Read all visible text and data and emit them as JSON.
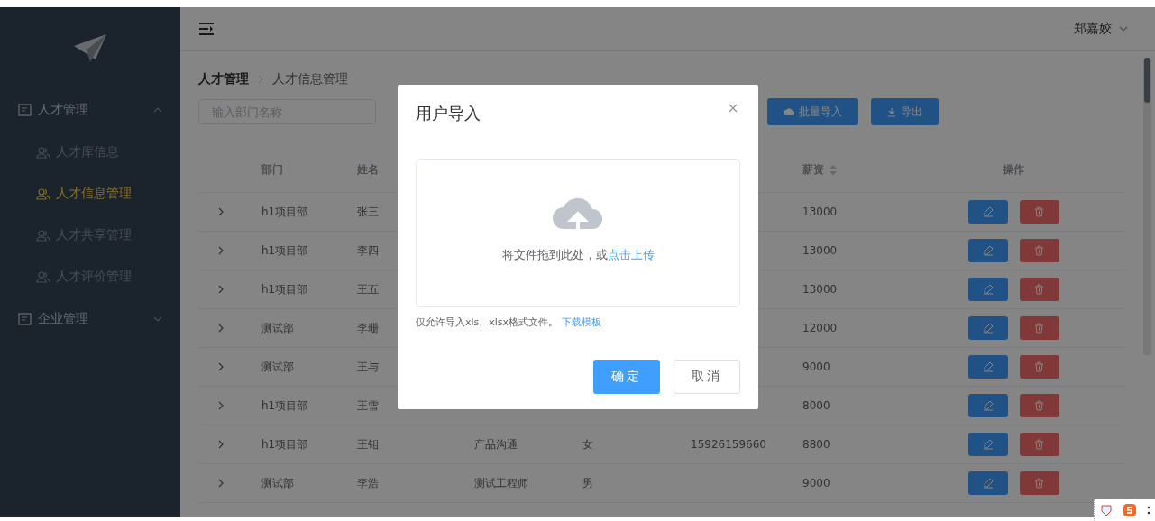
{
  "sidebar": {
    "menus": [
      {
        "label": "人才管理",
        "expanded": true,
        "children": [
          {
            "label": "人才库信息",
            "selected": false
          },
          {
            "label": "人才信息管理",
            "selected": true
          },
          {
            "label": "人才共享管理",
            "selected": false
          },
          {
            "label": "人才评价管理",
            "selected": false
          }
        ]
      },
      {
        "label": "企业管理",
        "expanded": false
      }
    ]
  },
  "header": {
    "user": "郑嘉姣"
  },
  "breadcrumb": [
    "人才管理",
    "人才信息管理"
  ],
  "toolbar": {
    "search": {
      "placeholder": "输入部门名称"
    },
    "buttons": [
      {
        "label": "批量导入",
        "kind": "upload"
      },
      {
        "label": "导出",
        "kind": "download"
      }
    ]
  },
  "table": {
    "columns": [
      {
        "label": "部门"
      },
      {
        "label": "姓名"
      },
      {},
      {},
      {},
      {
        "label": "薪资",
        "sortable": true
      },
      {
        "label": "操作"
      }
    ],
    "rows": [
      {
        "dept": "h1项目部",
        "name": "张三",
        "salary": "13000"
      },
      {
        "dept": "h1项目部",
        "name": "李四",
        "salary": "13000"
      },
      {
        "dept": "h1项目部",
        "name": "王五",
        "salary": "13000"
      },
      {
        "dept": "测试部",
        "name": "李珊",
        "salary": "12000"
      },
      {
        "dept": "测试部",
        "name": "王与",
        "salary": "9000"
      },
      {
        "dept": "h1项目部",
        "name": "王雪",
        "salary": "8000"
      },
      {
        "dept": "h1项目部",
        "name": "王钼",
        "column_3": "产品沟通",
        "column_4": "女",
        "column_5": "15926159660",
        "salary": "8800"
      },
      {
        "dept": "测试部",
        "name": "李浩",
        "column_3": "测试工程师",
        "column_4": "男",
        "salary": "9000"
      }
    ]
  },
  "dialog": {
    "title": "用户导入",
    "drop_text": "将文件拖到此处，或",
    "drop_link": "点击上传",
    "tip": "仅允许导入xls、xlsx格式文件。",
    "tip_link": "下载模板",
    "buttons": [
      {
        "label": "确定",
        "kind": "primary"
      },
      {
        "label": "取消",
        "kind": "default"
      }
    ]
  }
}
